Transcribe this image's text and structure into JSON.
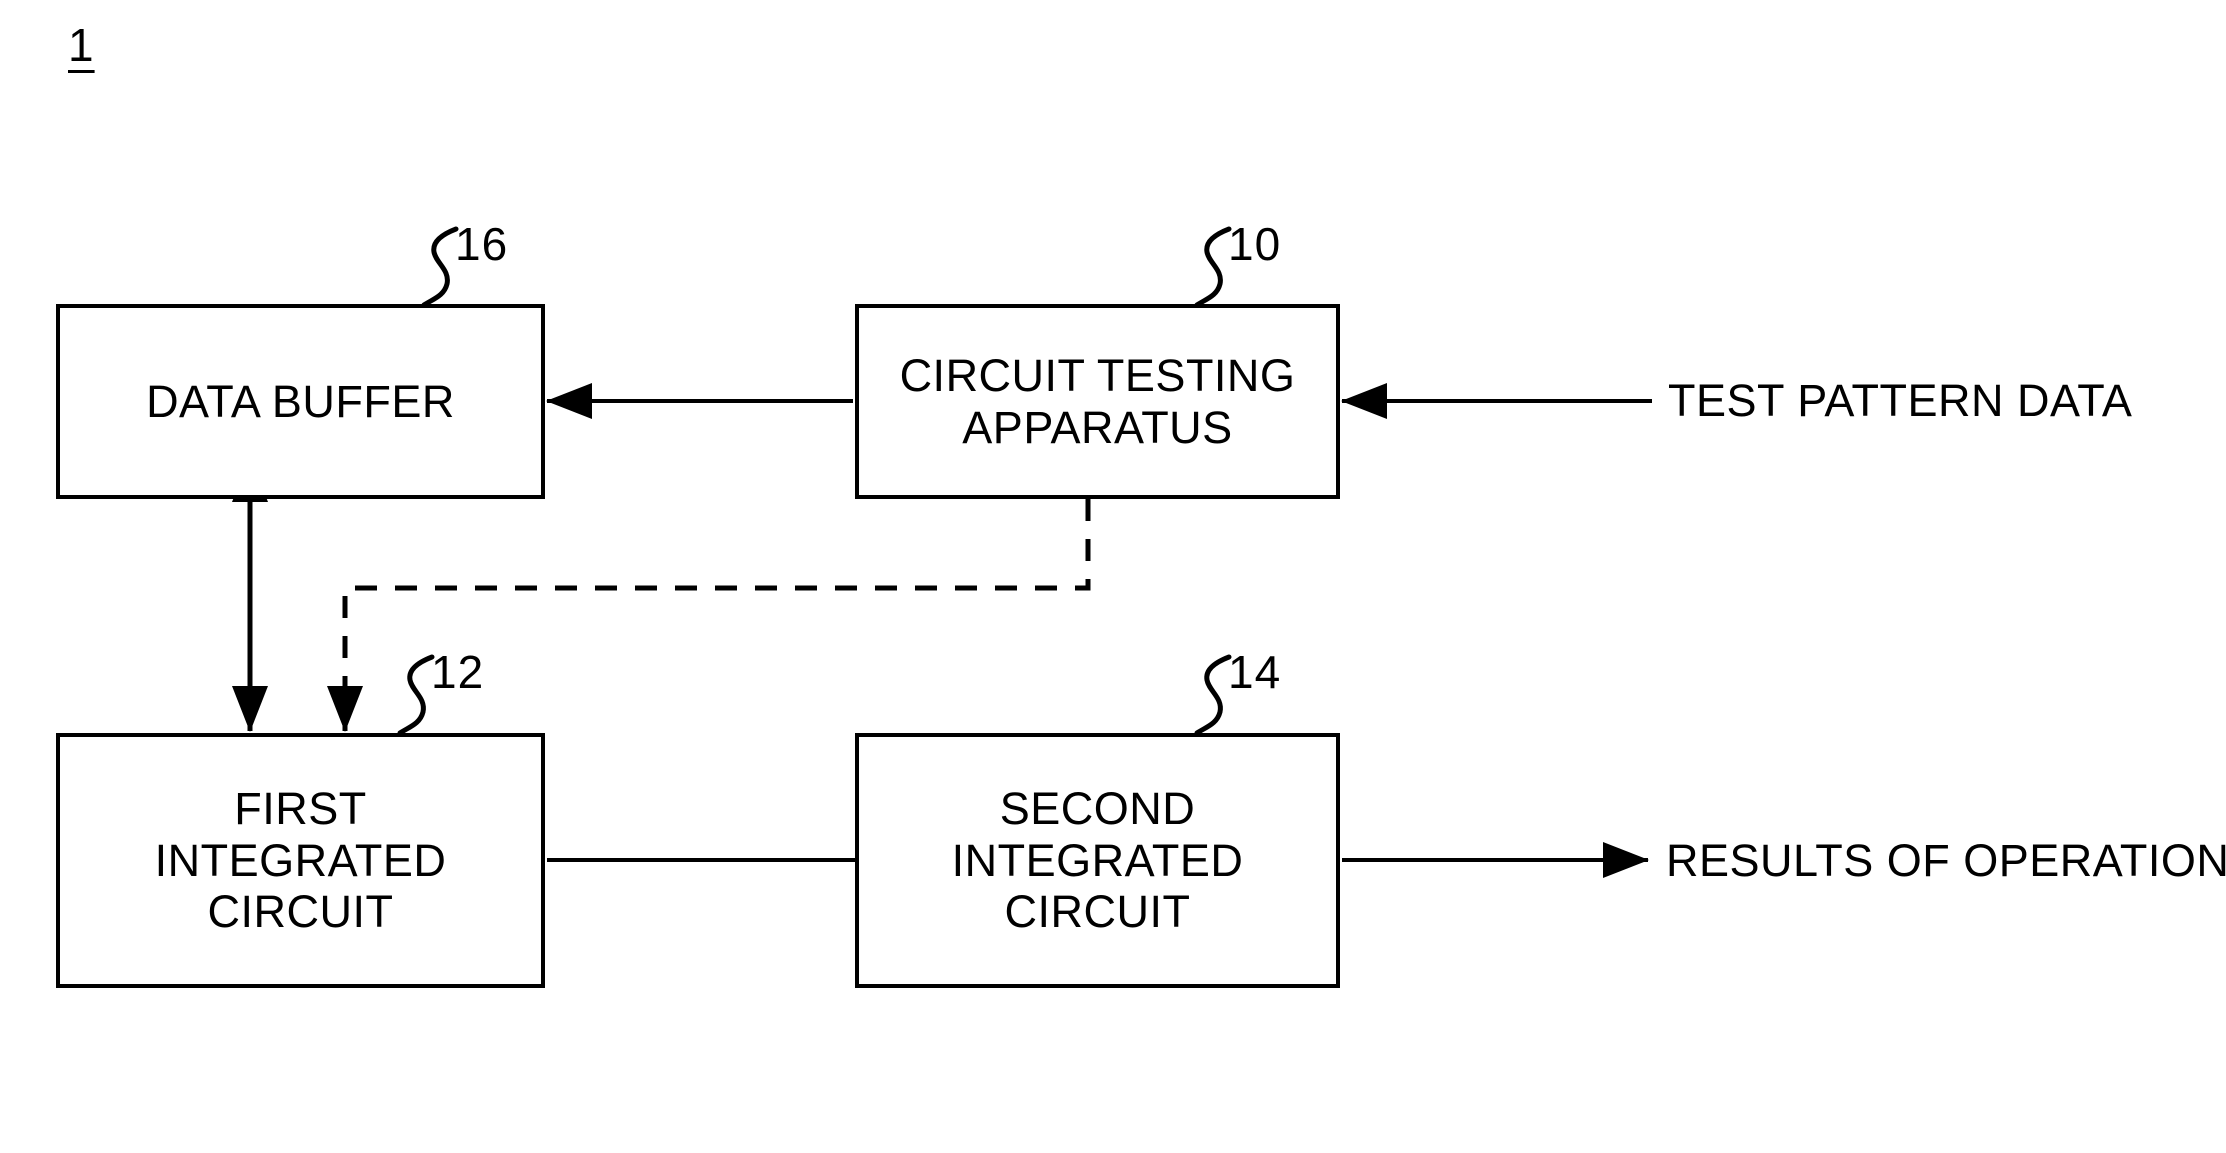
{
  "figure": {
    "number": "1"
  },
  "blocks": [
    {
      "id": "data-buffer",
      "label": "DATA BUFFER",
      "ref": "16"
    },
    {
      "id": "circuit-testing-apparatus",
      "label": "CIRCUIT TESTING\nAPPARATUS",
      "ref": "10"
    },
    {
      "id": "first-integrated-circuit",
      "label": "FIRST\nINTEGRATED\nCIRCUIT",
      "ref": "12"
    },
    {
      "id": "second-integrated-circuit",
      "label": "SECOND\nINTEGRATED\nCIRCUIT",
      "ref": "14"
    }
  ],
  "external_labels": {
    "test_pattern_data": "TEST PATTERN DATA",
    "results_of_operation": "RESULTS OF OPERATION"
  },
  "colors": {
    "stroke": "#000000",
    "background": "#ffffff"
  },
  "connectors": [
    {
      "id": "test-pattern-in",
      "from": "TEST PATTERN DATA",
      "to": "CIRCUIT TESTING APPARATUS",
      "style": "solid",
      "direction": "left"
    },
    {
      "id": "cta-to-data-buffer",
      "from": "CIRCUIT TESTING APPARATUS",
      "to": "DATA BUFFER",
      "style": "solid",
      "direction": "left"
    },
    {
      "id": "cta-to-first-ic",
      "from": "CIRCUIT TESTING APPARATUS",
      "to": "FIRST INTEGRATED CIRCUIT",
      "style": "dashed",
      "direction": "down"
    },
    {
      "id": "data-buffer-first-ic",
      "from": "DATA BUFFER",
      "to": "FIRST INTEGRATED CIRCUIT",
      "style": "solid",
      "direction": "bidirectional"
    },
    {
      "id": "first-ic-to-second-ic",
      "from": "FIRST INTEGRATED CIRCUIT",
      "to": "SECOND INTEGRATED CIRCUIT",
      "style": "solid",
      "direction": "right"
    },
    {
      "id": "results-out",
      "from": "SECOND INTEGRATED CIRCUIT",
      "to": "RESULTS OF OPERATION",
      "style": "solid",
      "direction": "right"
    }
  ]
}
